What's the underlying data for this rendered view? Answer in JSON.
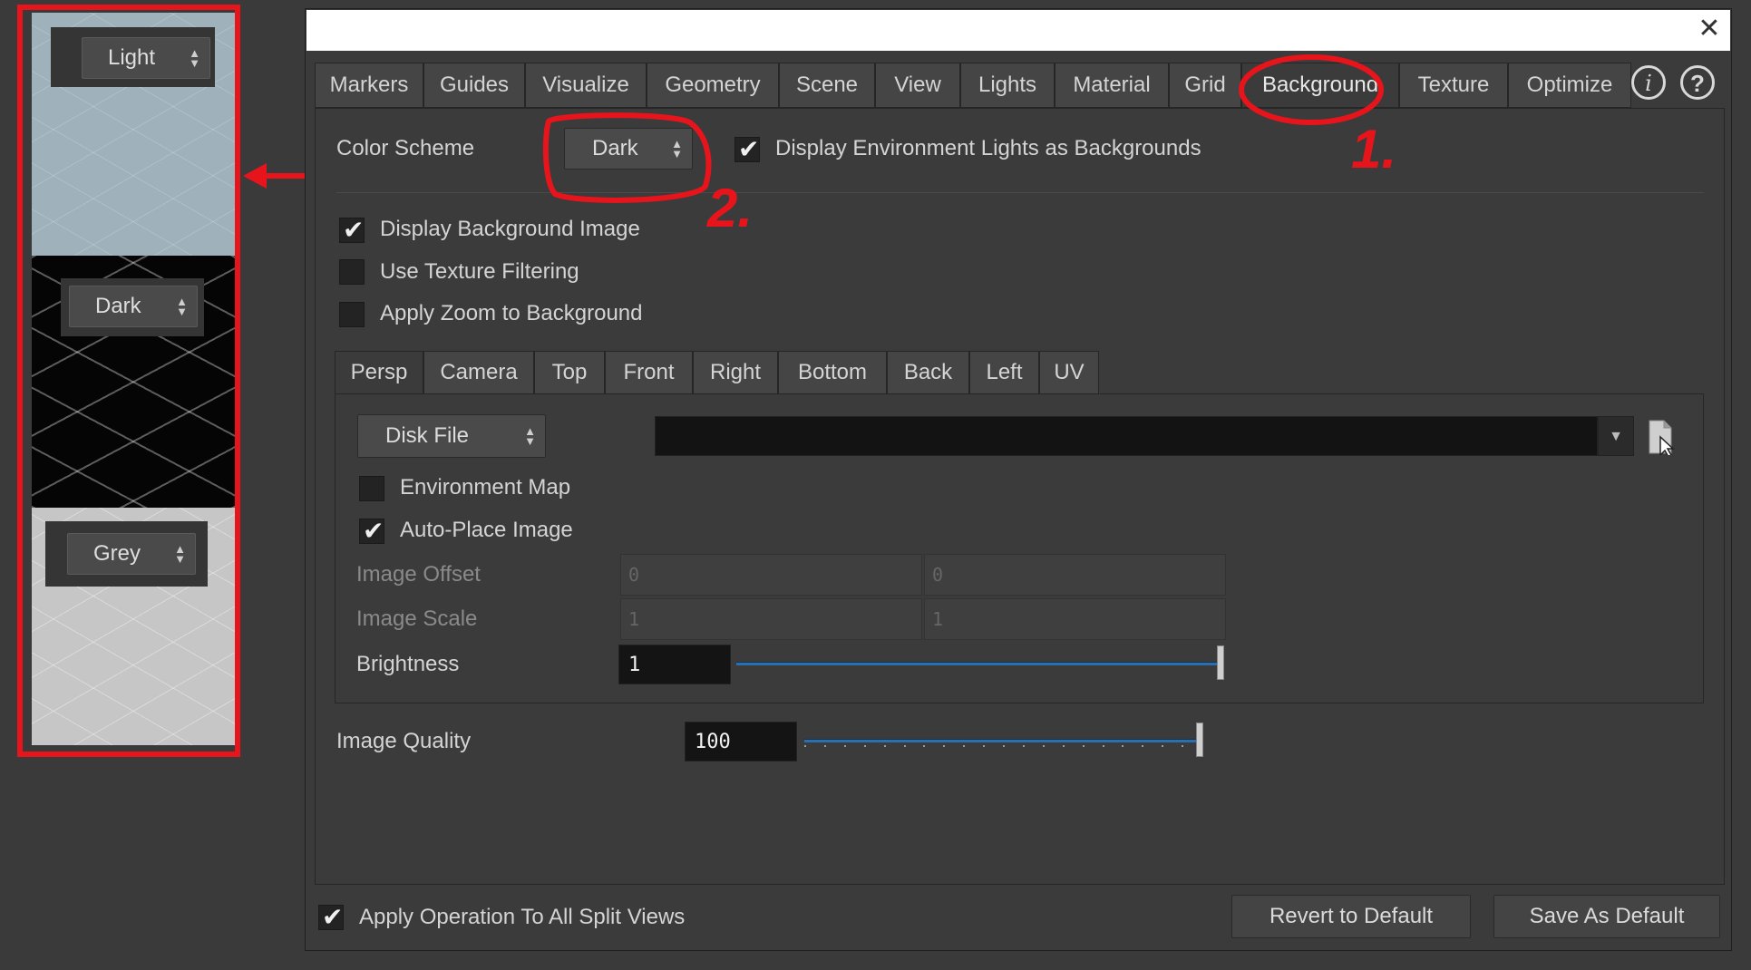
{
  "preview": {
    "light_label": "Light",
    "dark_label": "Dark",
    "grey_label": "Grey"
  },
  "dialog": {
    "close_glyph": "✕",
    "tabs": [
      "Markers",
      "Guides",
      "Visualize",
      "Geometry",
      "Scene",
      "View",
      "Lights",
      "Material",
      "Grid",
      "Background",
      "Texture",
      "Optimize"
    ],
    "active_tab": "Background",
    "info_glyph": "i",
    "help_glyph": "?",
    "color_scheme_label": "Color Scheme",
    "color_scheme_value": "Dark",
    "env_lights_bg_label": "Display Environment Lights as Backgrounds",
    "env_lights_bg_checked": true,
    "display_bg_image_label": "Display Background Image",
    "display_bg_image_checked": true,
    "texture_filtering_label": "Use Texture Filtering",
    "texture_filtering_checked": false,
    "apply_zoom_label": "Apply Zoom to Background",
    "apply_zoom_checked": false,
    "view_tabs": [
      "Persp",
      "Camera",
      "Top",
      "Front",
      "Right",
      "Bottom",
      "Back",
      "Left",
      "UV"
    ],
    "active_view_tab": "Persp",
    "source_value": "Disk File",
    "path_value": "",
    "environment_map_label": "Environment Map",
    "environment_map_checked": false,
    "auto_place_label": "Auto-Place Image",
    "auto_place_checked": true,
    "image_offset_label": "Image Offset",
    "image_offset_x": "0",
    "image_offset_y": "0",
    "image_scale_label": "Image Scale",
    "image_scale_x": "1",
    "image_scale_y": "1",
    "brightness_label": "Brightness",
    "brightness_value": "1",
    "brightness_slider_fraction": 1.0,
    "image_quality_label": "Image Quality",
    "image_quality_value": "100",
    "image_quality_slider_fraction": 1.0,
    "apply_all_label": "Apply Operation To All Split Views",
    "apply_all_checked": true,
    "revert_label": "Revert to Default",
    "save_label": "Save As Default"
  },
  "annotations": {
    "step1": "1.",
    "step2": "2.",
    "color": "#e8141c"
  }
}
